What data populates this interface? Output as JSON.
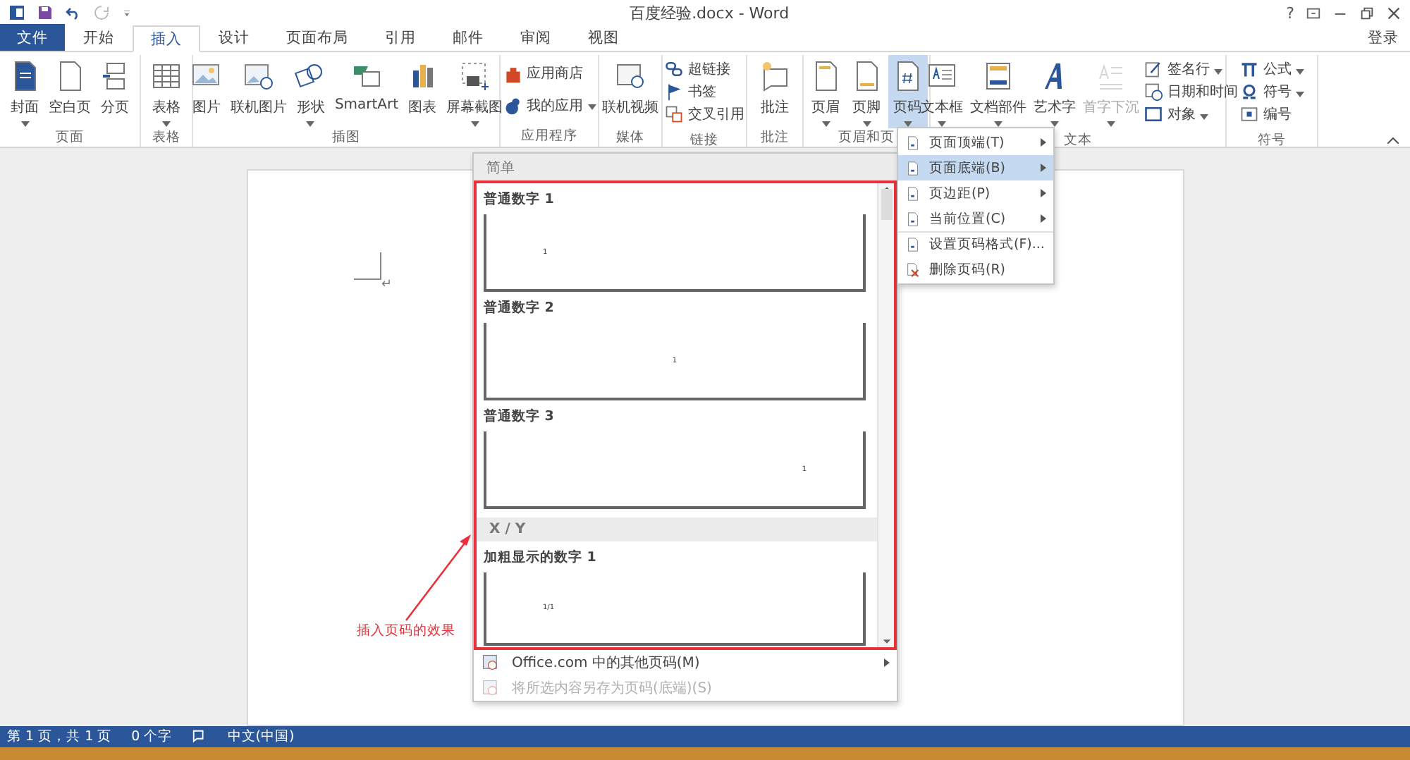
{
  "title_bar": {
    "title": "百度经验.docx - Word",
    "help": "?",
    "signin": "登录"
  },
  "tabs": [
    {
      "label": "文件",
      "kind": "file",
      "selected": false
    },
    {
      "label": "开始",
      "kind": "tab",
      "selected": false
    },
    {
      "label": "插入",
      "kind": "tab",
      "selected": true
    },
    {
      "label": "设计",
      "kind": "tab",
      "selected": false
    },
    {
      "label": "页面布局",
      "kind": "tab",
      "selected": false
    },
    {
      "label": "引用",
      "kind": "tab",
      "selected": false
    },
    {
      "label": "邮件",
      "kind": "tab",
      "selected": false
    },
    {
      "label": "审阅",
      "kind": "tab",
      "selected": false
    },
    {
      "label": "视图",
      "kind": "tab",
      "selected": false
    }
  ],
  "ribbon": {
    "groups": [
      {
        "label": "页面",
        "buttons": [
          {
            "label": "封面",
            "dropdown": true,
            "pressed": false,
            "disabled": false
          },
          {
            "label": "空白页",
            "dropdown": false,
            "pressed": false,
            "disabled": false
          },
          {
            "label": "分页",
            "dropdown": false,
            "pressed": false,
            "disabled": false
          }
        ]
      },
      {
        "label": "表格",
        "buttons": [
          {
            "label": "表格",
            "dropdown": true,
            "pressed": false,
            "disabled": false
          }
        ]
      },
      {
        "label": "插图",
        "buttons": [
          {
            "label": "图片",
            "dropdown": false,
            "pressed": false,
            "disabled": false
          },
          {
            "label": "联机图片",
            "dropdown": false,
            "pressed": false,
            "disabled": false
          },
          {
            "label": "形状",
            "dropdown": true,
            "pressed": false,
            "disabled": false
          },
          {
            "label": "SmartArt",
            "dropdown": false,
            "pressed": false,
            "disabled": false
          },
          {
            "label": "图表",
            "dropdown": false,
            "pressed": false,
            "disabled": false
          },
          {
            "label": "屏幕截图",
            "dropdown": true,
            "pressed": false,
            "disabled": false
          }
        ]
      },
      {
        "label": "应用程序",
        "stack": [
          {
            "label": "应用商店",
            "dropdown": false
          },
          {
            "label": "我的应用",
            "dropdown": true
          }
        ]
      },
      {
        "label": "媒体",
        "buttons": [
          {
            "label": "联机视频",
            "dropdown": false,
            "pressed": false,
            "disabled": false
          }
        ]
      },
      {
        "label": "链接",
        "stack": [
          {
            "label": "超链接",
            "dropdown": false
          },
          {
            "label": "书签",
            "dropdown": false
          },
          {
            "label": "交叉引用",
            "dropdown": false
          }
        ]
      },
      {
        "label": "批注",
        "buttons": [
          {
            "label": "批注",
            "dropdown": false,
            "pressed": false,
            "disabled": false
          }
        ]
      },
      {
        "label": "页眉和页",
        "buttons": [
          {
            "label": "页眉",
            "dropdown": true,
            "pressed": false,
            "disabled": false
          },
          {
            "label": "页脚",
            "dropdown": true,
            "pressed": false,
            "disabled": false
          },
          {
            "label": "页码",
            "dropdown": true,
            "pressed": true,
            "disabled": false
          }
        ]
      },
      {
        "label": "文本",
        "buttons": [
          {
            "label": "文本框",
            "dropdown": true,
            "pressed": false,
            "disabled": false
          },
          {
            "label": "文档部件",
            "dropdown": true,
            "pressed": false,
            "disabled": false
          },
          {
            "label": "艺术字",
            "dropdown": true,
            "pressed": false,
            "disabled": false
          },
          {
            "label": "首字下沉",
            "dropdown": true,
            "pressed": false,
            "disabled": true
          }
        ],
        "stack": [
          {
            "label": "签名行",
            "dropdown": true
          },
          {
            "label": "日期和时间",
            "dropdown": false
          },
          {
            "label": "对象",
            "dropdown": true
          }
        ]
      },
      {
        "label": "符号",
        "stack": [
          {
            "label": "公式",
            "dropdown": true
          },
          {
            "label": "符号",
            "dropdown": true
          },
          {
            "label": "编号",
            "dropdown": false
          }
        ]
      }
    ]
  },
  "document": {
    "paragraph_mark": "↵"
  },
  "gallery": {
    "sections": [
      {
        "header": "简单",
        "items": [
          {
            "title": "普通数字 1",
            "number": "1",
            "kind": "left"
          },
          {
            "title": "普通数字 2",
            "number": "1",
            "kind": "center"
          },
          {
            "title": "普通数字 3",
            "number": "1",
            "kind": "right"
          }
        ]
      },
      {
        "header": "X / Y",
        "items": [
          {
            "title": "加粗显示的数字 1",
            "number": "1/1",
            "kind": "left"
          }
        ]
      }
    ],
    "footer": [
      {
        "label": "Office.com 中的其他页码(M)",
        "submenu": true,
        "disabled": false
      },
      {
        "label": "将所选内容另存为页码(底端)(S)",
        "submenu": false,
        "disabled": true
      }
    ]
  },
  "submenu": [
    {
      "label": "页面顶端(T)",
      "submenu": true,
      "selected": false
    },
    {
      "label": "页面底端(B)",
      "submenu": true,
      "selected": true
    },
    {
      "label": "页边距(P)",
      "submenu": true,
      "selected": false
    },
    {
      "label": "当前位置(C)",
      "submenu": true,
      "selected": false
    },
    {
      "label": "设置页码格式(F)...",
      "submenu": false,
      "selected": false
    },
    {
      "label": "删除页码(R)",
      "submenu": false,
      "selected": false
    }
  ],
  "annotation": {
    "label": "插入页码的效果"
  },
  "status_bar": {
    "page": "第 1 页，共 1 页",
    "words": "0 个字",
    "language": "中文(中国)"
  }
}
